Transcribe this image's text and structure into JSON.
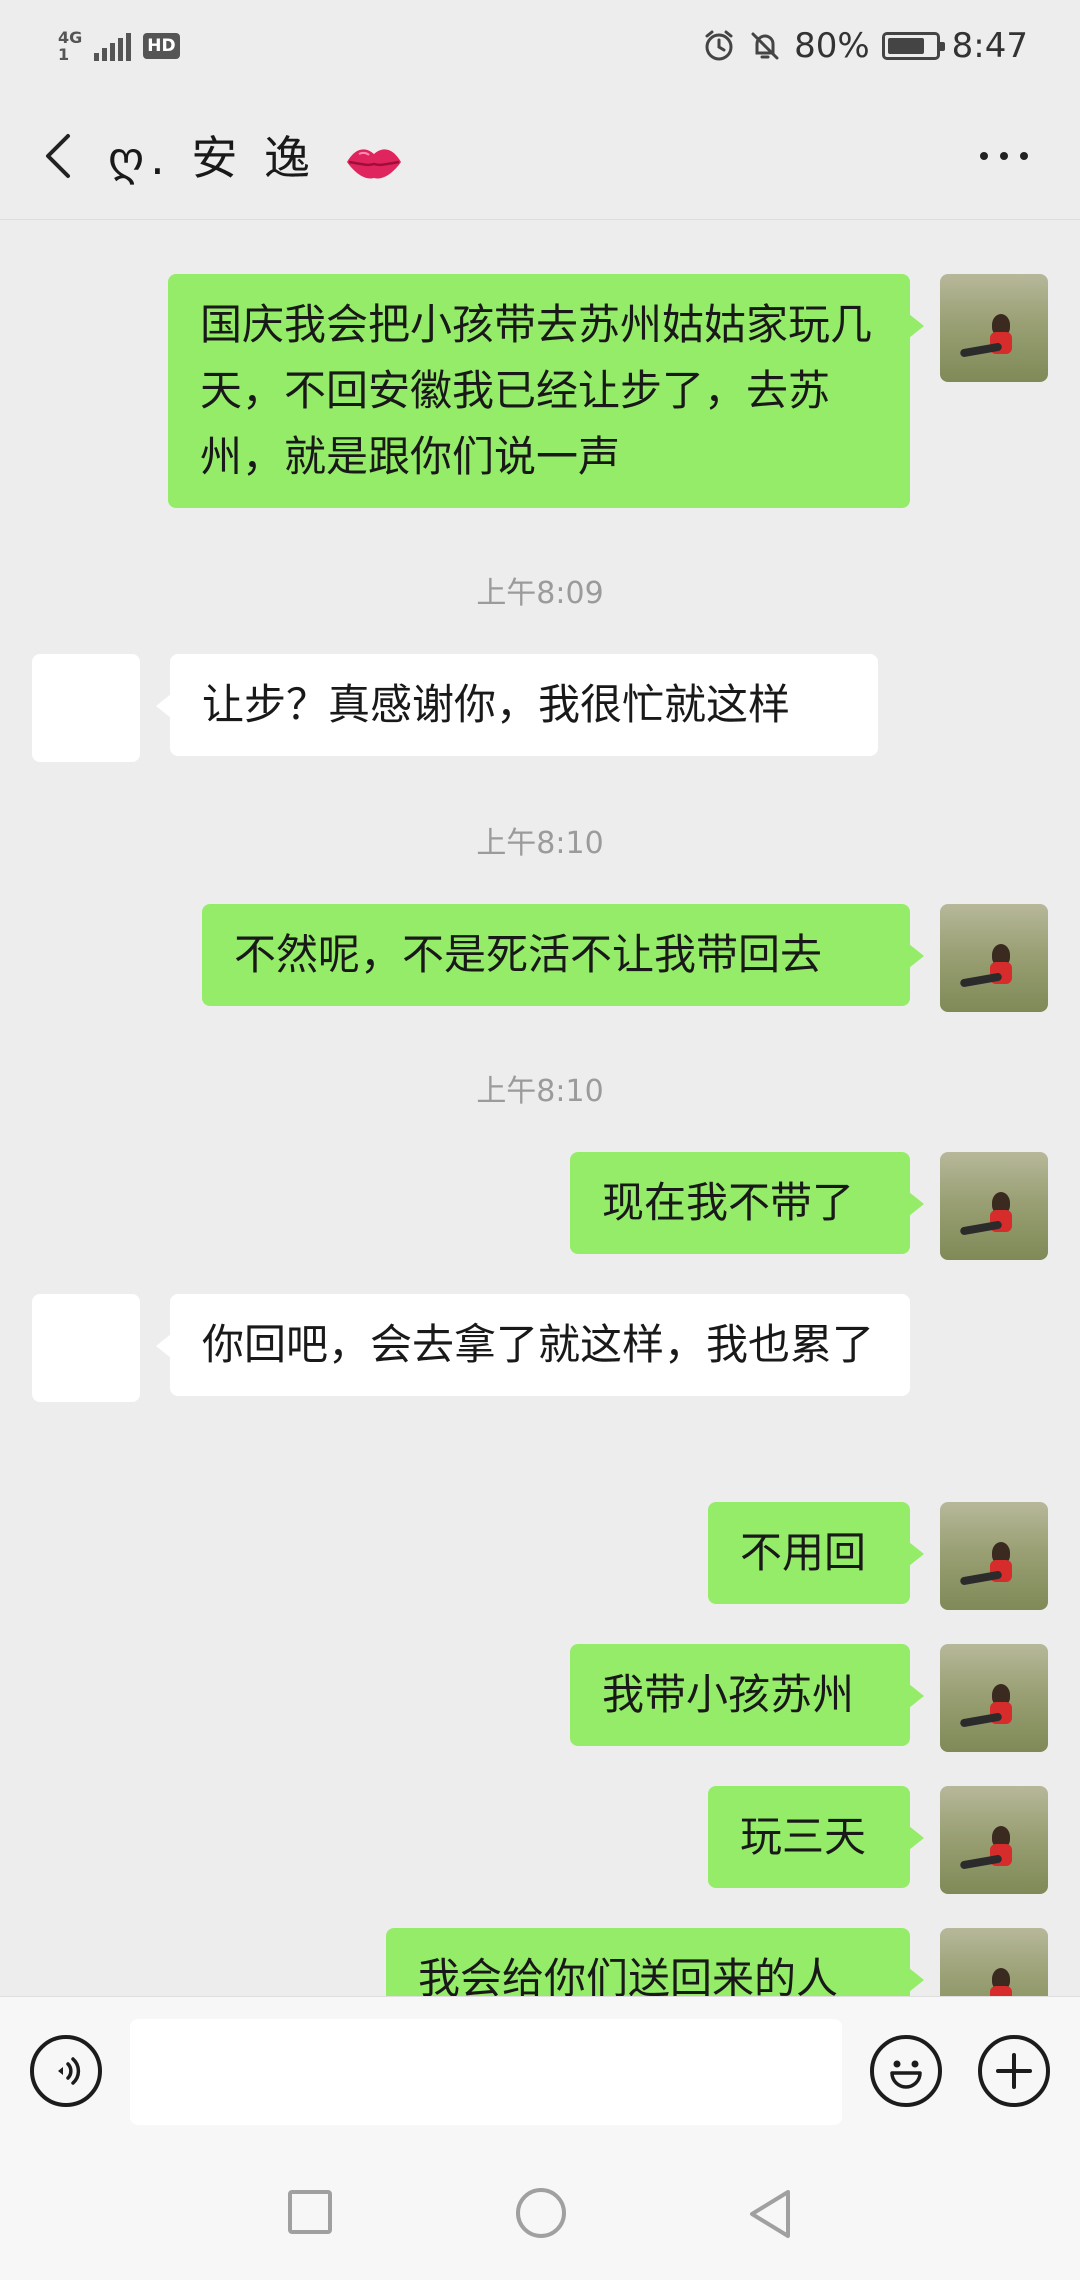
{
  "status_bar": {
    "network": "4G",
    "sim": "1",
    "hd": "HD",
    "battery": "80%",
    "battery_level": 0.8,
    "time": "8:47",
    "icons": [
      "alarm-icon",
      "mute-icon",
      "battery-icon",
      "signal-icon"
    ]
  },
  "header": {
    "title": "ღ. 安 逸",
    "emoji": "lips-emoji",
    "back_icon": "chevron-left-icon",
    "more_icon": "more-dots-icon"
  },
  "messages": [
    {
      "from": "self",
      "text": "国庆我会把小孩带去苏州姑姑家玩几天，不回安徽我已经让步了，去苏州，就是跟你们说一声"
    },
    {
      "time": "上午8:09"
    },
    {
      "from": "other",
      "text": "让步？真感谢你，我很忙就这样"
    },
    {
      "time": "上午8:10"
    },
    {
      "from": "self",
      "text": "不然呢，不是死活不让我带回去"
    },
    {
      "time": "上午8:10"
    },
    {
      "from": "self",
      "text": "现在我不带了"
    },
    {
      "from": "other",
      "text": "你回吧，会去拿了就这样，我也累了"
    },
    {
      "from": "self",
      "text": "不用回"
    },
    {
      "from": "self",
      "text": "我带小孩苏州"
    },
    {
      "from": "self",
      "text": "玩三天"
    },
    {
      "from": "self",
      "text": "我会给你们送回来的人"
    }
  ],
  "input_bar": {
    "voice_icon": "voice-icon",
    "emoji_icon": "emoji-icon",
    "plus_icon": "plus-icon",
    "text": ""
  },
  "nav_bar": {
    "icons": [
      "recent-apps-icon",
      "home-icon",
      "back-icon"
    ]
  },
  "colors": {
    "self_bubble": "#95ec69",
    "other_bubble": "#ffffff",
    "background": "#ededed"
  }
}
